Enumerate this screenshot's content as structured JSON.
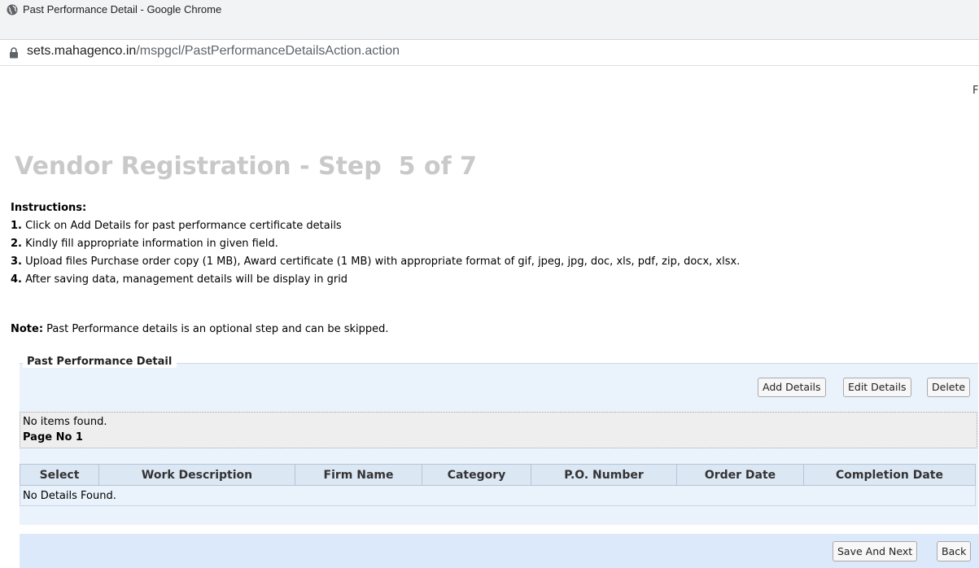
{
  "browser": {
    "window_title": "Past Performance Detail - Google Chrome",
    "url_host": "sets.mahagenco.in",
    "url_path": "/mspgcl/PastPerformanceDetailsAction.action"
  },
  "header_right_fragment": "F",
  "page": {
    "heading": "Vendor Registration - Step  5 of 7",
    "instructions_title": "Instructions:",
    "instructions": [
      {
        "num": "1.",
        "text": " Click on Add Details for past performance certificate details"
      },
      {
        "num": "2.",
        "text": " Kindly fill appropriate information in given field."
      },
      {
        "num": "3.",
        "text": " Upload files Purchase order copy (1 MB), Award certificate (1 MB) with appropriate format of gif, jpeg, jpg, doc, xls, pdf, zip, docx, xlsx."
      },
      {
        "num": "4.",
        "text": " After saving data, management details will be display in grid"
      }
    ],
    "note_label": "Note:",
    "note_text": " Past Performance details is an optional step and can be skipped."
  },
  "section": {
    "legend": "Past Performance Detail",
    "buttons": {
      "add": "Add Details",
      "edit": "Edit Details",
      "delete": "Delete"
    },
    "pager": {
      "empty_text": "No items found.",
      "page_label": "Page No 1"
    },
    "table": {
      "columns": [
        "Select",
        "Work Description",
        "Firm Name",
        "Category",
        "P.O. Number",
        "Order Date",
        "Completion Date"
      ],
      "empty_message": "No Details Found."
    }
  },
  "footer": {
    "save_next": "Save And Next",
    "back": "Back"
  },
  "colors": {
    "heading_gray": "#c9c9c9",
    "panel_blue": "#eaf2fc",
    "footer_blue": "#dce9fb"
  }
}
